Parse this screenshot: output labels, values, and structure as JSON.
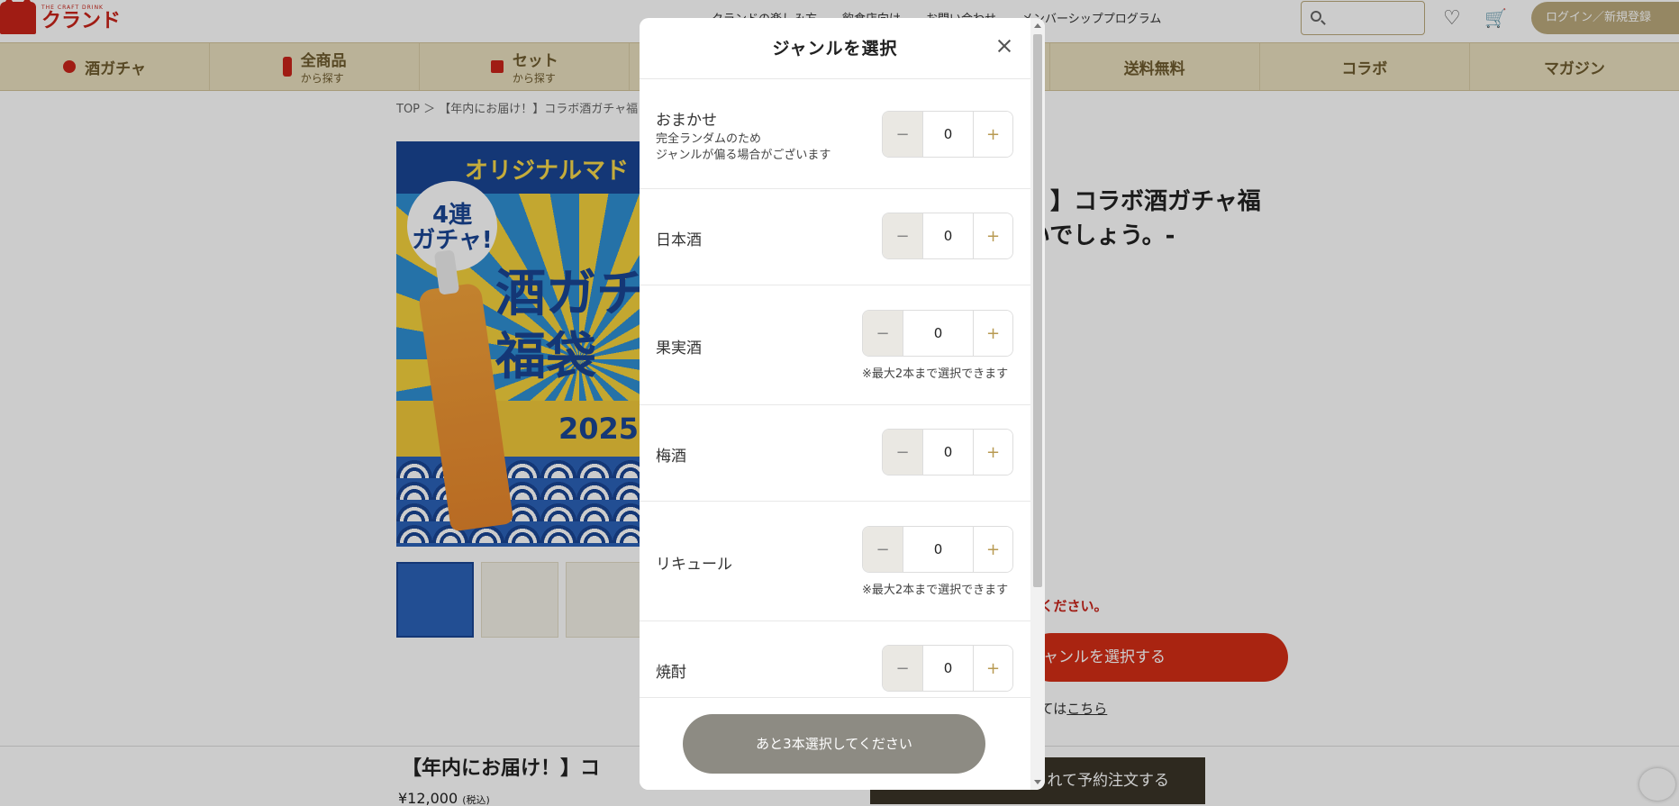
{
  "header": {
    "logo_sub": "THE CRAFT DRINK",
    "logo_main": "クランド",
    "links": [
      "クランドの楽しみ方",
      "飲食店向け",
      "お問い合わせ",
      "メンバーシッププログラム"
    ],
    "login": "ログイン／新規登録"
  },
  "nav": {
    "items": [
      {
        "label": "酒ガチャ",
        "sub": ""
      },
      {
        "label": "全商品",
        "sub": "から探す"
      },
      {
        "label": "セット",
        "sub": "から探す"
      },
      {
        "label": "",
        "sub": ""
      },
      {
        "label": "",
        "sub": ""
      },
      {
        "label": "送料無料",
        "sub": ""
      },
      {
        "label": "コラボ",
        "sub": ""
      },
      {
        "label": "マガジン",
        "sub": ""
      }
    ]
  },
  "breadcrumb": "TOP ＞ 【年内にお届け！】コラボ酒ガチャ福",
  "hero": {
    "top_text": "オリジナルマド",
    "badge_line1": "4連",
    "badge_line2": "ガチャ!",
    "title_line1": "酒ガチ",
    "title_line2": "福袋",
    "year": "2025"
  },
  "product": {
    "title_line1": "！】コラボ酒ガチャ福",
    "title_line2": "いでしょう。-",
    "warning": "てください。",
    "cta": "ャンルを選択する",
    "link_prefix": "いては",
    "link_text": "こちら"
  },
  "bottom_bar": {
    "title": "【年内にお届け！】コ",
    "price": "¥12,000",
    "tax": "(税込)",
    "button": "れて予約注文する"
  },
  "modal": {
    "title": "ジャンルを選択",
    "genres": [
      {
        "name": "おまかせ",
        "desc1": "完全ランダムのため",
        "desc2": "ジャンルが偏る場合がございます",
        "value": "0",
        "note": ""
      },
      {
        "name": "日本酒",
        "desc1": "",
        "desc2": "",
        "value": "0",
        "note": ""
      },
      {
        "name": "果実酒",
        "desc1": "",
        "desc2": "",
        "value": "0",
        "note": "※最大2本まで選択できます"
      },
      {
        "name": "梅酒",
        "desc1": "",
        "desc2": "",
        "value": "0",
        "note": ""
      },
      {
        "name": "リキュール",
        "desc1": "",
        "desc2": "",
        "value": "0",
        "note": "※最大2本まで選択できます"
      },
      {
        "name": "焼酎",
        "desc1": "",
        "desc2": "",
        "value": "0",
        "note": ""
      }
    ],
    "submit": "あと3本選択してください",
    "minus_symbol": "−",
    "plus_symbol": "+"
  }
}
